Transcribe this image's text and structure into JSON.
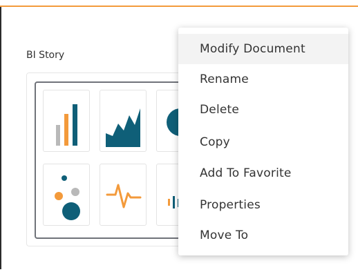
{
  "card": {
    "title": "BI Story"
  },
  "context_menu": {
    "items": [
      {
        "label": "Modify Document"
      },
      {
        "label": "Rename"
      },
      {
        "label": "Delete"
      },
      {
        "label": "Copy"
      },
      {
        "label": "Add To Favorite"
      },
      {
        "label": "Properties"
      },
      {
        "label": "Move To"
      }
    ]
  },
  "colors": {
    "accent_orange": "#F39A3B",
    "chart_teal": "#0F5F78",
    "chart_gray": "#B9B9B9"
  },
  "thumbnail_icons": [
    "bar-chart-icon",
    "area-chart-icon",
    "pie-chart-icon",
    "bubble-chart-icon",
    "pulse-line-icon",
    "small-bars-icon"
  ]
}
